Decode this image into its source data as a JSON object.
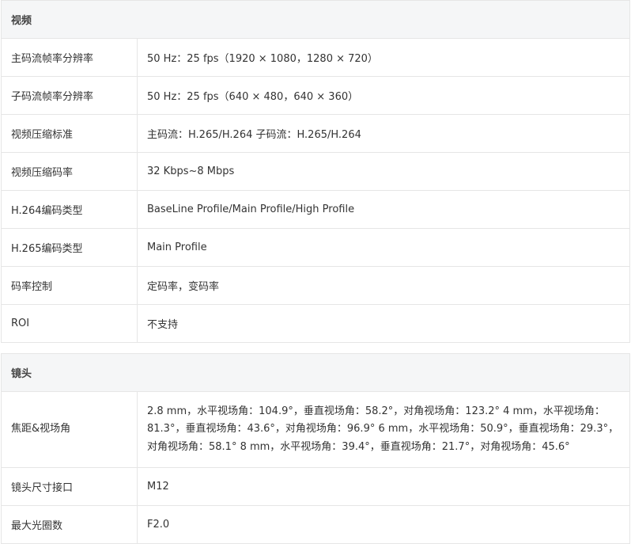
{
  "sections": [
    {
      "title": "视频",
      "rows": [
        {
          "key": "主码流帧率分辨率",
          "value": "50 Hz：25 fps（1920 × 1080，1280 × 720）"
        },
        {
          "key": "子码流帧率分辨率",
          "value": "50 Hz：25 fps（640 × 480，640 × 360）"
        },
        {
          "key": "视频压缩标准",
          "value": "主码流：H.265/H.264 子码流：H.265/H.264"
        },
        {
          "key": "视频压缩码率",
          "value": "32 Kbps~8 Mbps"
        },
        {
          "key": "H.264编码类型",
          "value": "BaseLine Profile/Main Profile/High Profile"
        },
        {
          "key": "H.265编码类型",
          "value": "Main Profile"
        },
        {
          "key": "码率控制",
          "value": "定码率，变码率"
        },
        {
          "key": "ROI",
          "value": "不支持"
        }
      ]
    },
    {
      "title": "镜头",
      "rows": [
        {
          "key": "焦距&视场角",
          "value": "2.8 mm，水平视场角：104.9°，垂直视场角：58.2°，对角视场角：123.2° 4 mm，水平视场角：81.3°，垂直视场角：43.6°，对角视场角：96.9° 6 mm，水平视场角：50.9°，垂直视场角：29.3°，对角视场角：58.1° 8 mm，水平视场角：39.4°，垂直视场角：21.7°，对角视场角：45.6°"
        },
        {
          "key": "镜头尺寸接口",
          "value": "M12"
        },
        {
          "key": "最大光圈数",
          "value": "F2.0"
        }
      ]
    }
  ]
}
